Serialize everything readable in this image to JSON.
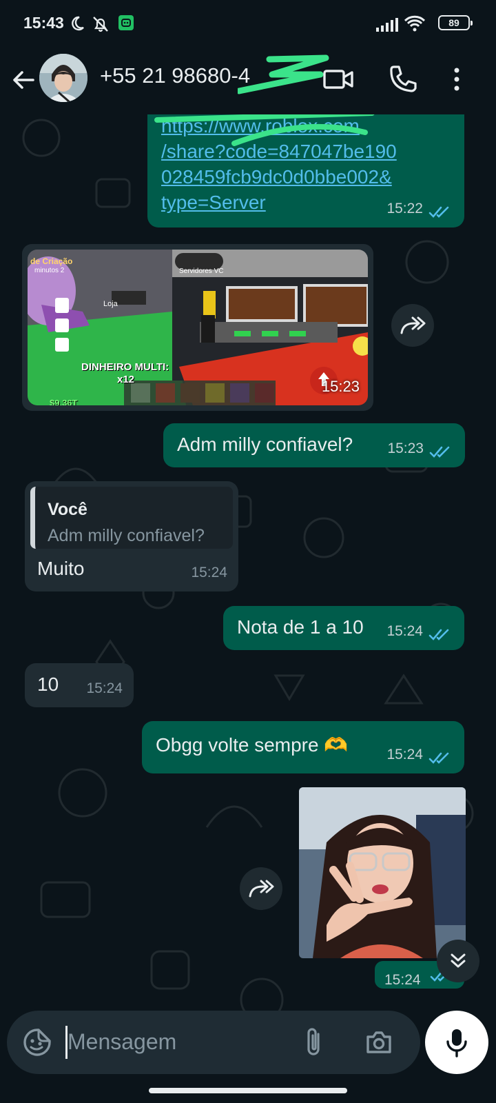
{
  "status_bar": {
    "time": "15:43",
    "battery": "89"
  },
  "header": {
    "contact_name": "+55 21 98680-4",
    "icons": [
      "back-arrow-icon",
      "video-call-icon",
      "voice-call-icon",
      "more-options-icon"
    ]
  },
  "messages": [
    {
      "type": "outgoing-link",
      "lines": [
        "https://www.roblox.com",
        "/share?code=847047be190",
        "028459fcb9dc0d0bbe002&",
        "type=Server"
      ],
      "time": "15:22",
      "status": "read"
    },
    {
      "type": "incoming-image",
      "image_texts": {
        "top_left": "de Criação",
        "top_left_sub": "minutos 2",
        "server_button": "Servidores VC",
        "shop": "Loja",
        "multiplier_label": "DINHEIRO MULTI:",
        "multiplier_value": "x12",
        "money": "$9.36T"
      },
      "time": "15:23"
    },
    {
      "type": "outgoing",
      "text": "Adm milly confiavel?",
      "time": "15:23",
      "status": "read"
    },
    {
      "type": "incoming-reply",
      "quote_author": "Você",
      "quote_text": "Adm milly confiavel?",
      "text": "Muito",
      "time": "15:24"
    },
    {
      "type": "outgoing",
      "text": "Nota de 1 a 10",
      "time": "15:24",
      "status": "read"
    },
    {
      "type": "incoming",
      "text": "10",
      "time": "15:24"
    },
    {
      "type": "outgoing",
      "text": "Obgg volte sempre 🫶",
      "time": "15:24",
      "status": "read"
    },
    {
      "type": "outgoing-image",
      "time": "15:24",
      "status": "read"
    }
  ],
  "input": {
    "placeholder": "Mensagem"
  },
  "colors": {
    "background": "#0b141a",
    "outgoing_bubble": "#005c4b",
    "incoming_bubble": "#202c33",
    "link": "#53bdeb",
    "read_ticks": "#53bdeb"
  }
}
